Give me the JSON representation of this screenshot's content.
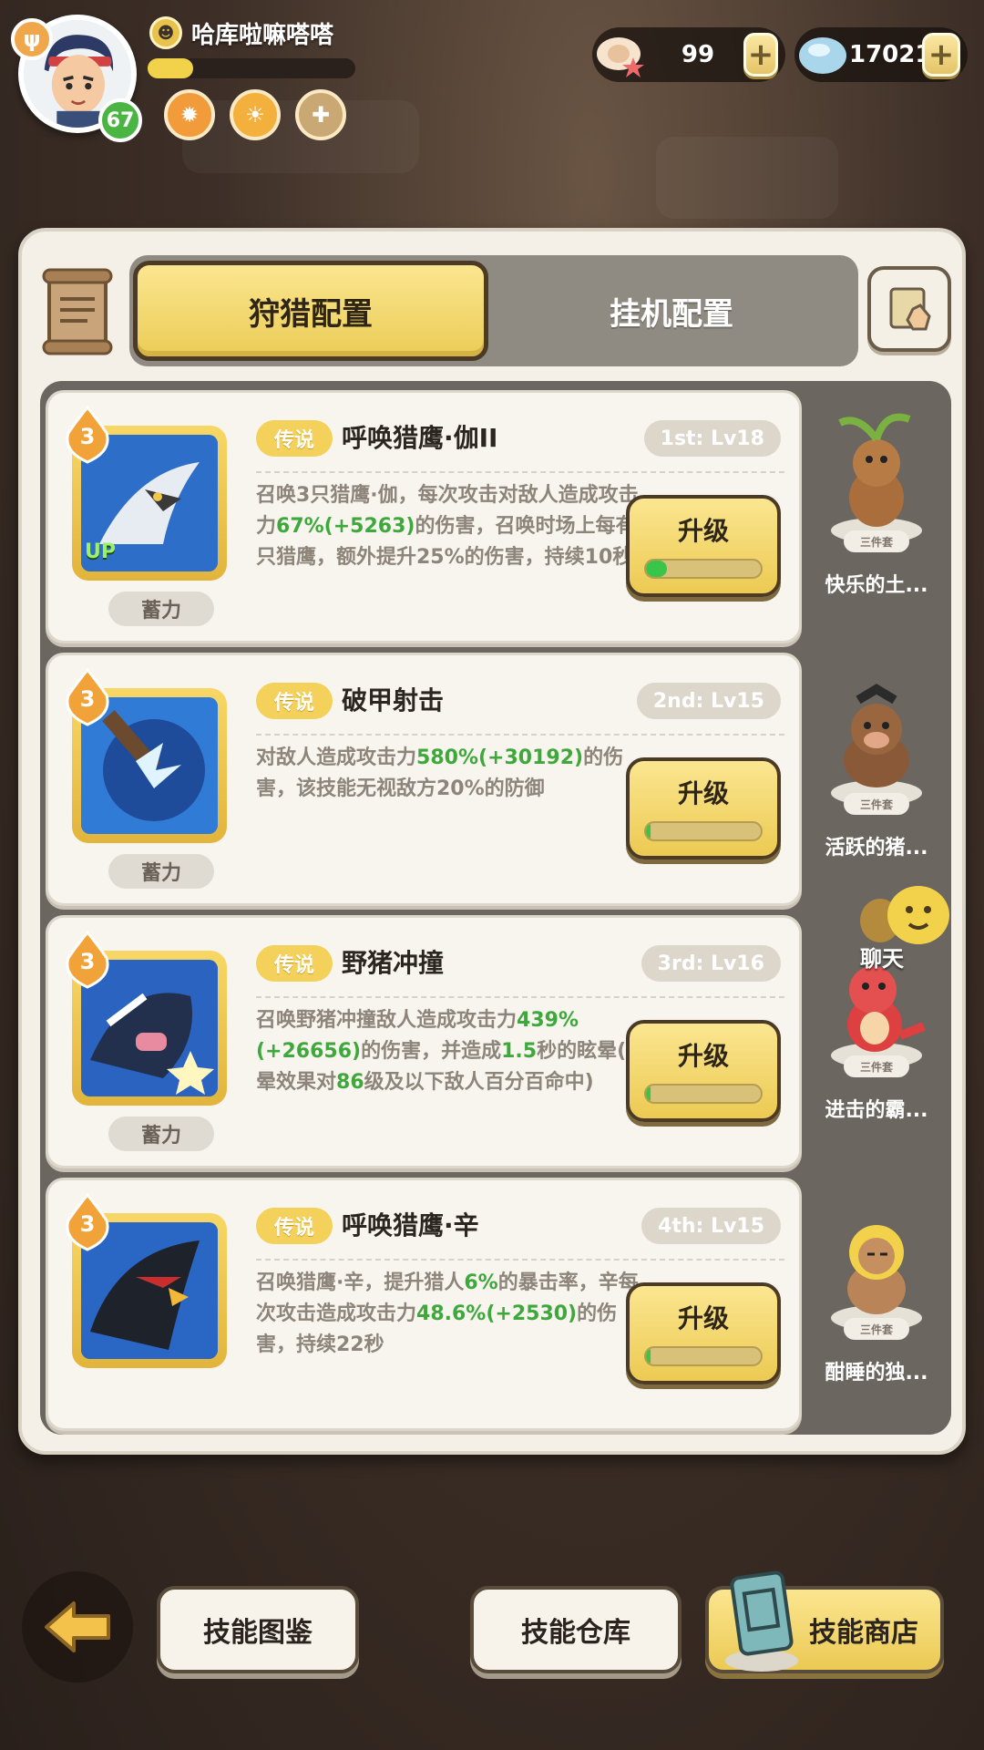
{
  "player": {
    "name": "哈库啦嘛嗒嗒",
    "level": "67",
    "xp_fraction": 0.22,
    "buffs": [
      "fire-buff-icon",
      "sun-buff-icon",
      "shield-buff-icon"
    ]
  },
  "currencies": [
    {
      "icon": "shell-starfish-icon",
      "value": "99"
    },
    {
      "icon": "crystal-icon",
      "value": "17021"
    }
  ],
  "tabs": {
    "hunt_config": "狩猎配置",
    "idle_config": "挂机配置"
  },
  "skills": [
    {
      "rank": "3",
      "up": "UP",
      "tag": "蓄力",
      "rarity": "传说",
      "name": "呼唤猎鹰·伽II",
      "slot": "1st: Lv18",
      "desc": "召唤3只猎鹰·伽，每次攻击对敌人造成攻击力|67%(+5263)|的伤害，召唤时场上每有1只猎鹰，额外提升25%的伤害，持续10秒",
      "upgrade_label": "升级",
      "progress": 0.18,
      "pet_name": "快乐的土...",
      "set_tag": "三件套"
    },
    {
      "rank": "3",
      "up": "",
      "tag": "蓄力",
      "rarity": "传说",
      "name": "破甲射击",
      "slot": "2nd: Lv15",
      "desc": "对敌人造成攻击力|580%(+30192)|的伤害，该技能无视敌方20%的防御",
      "upgrade_label": "升级",
      "progress": 0.04,
      "pet_name": "活跃的猪...",
      "set_tag": "三件套"
    },
    {
      "rank": "3",
      "up": "",
      "tag": "蓄力",
      "rarity": "传说",
      "name": "野猪冲撞",
      "slot": "3rd: Lv16",
      "desc": "召唤野猪冲撞敌人造成攻击力|439%(+26656)|的伤害，并造成|1.5|秒的眩晕(眩晕效果对|86|级及以下敌人百分百命中)",
      "upgrade_label": "升级",
      "progress": 0.04,
      "pet_name": "进击的霸...",
      "set_tag": "三件套"
    },
    {
      "rank": "3",
      "up": "",
      "tag": "",
      "rarity": "传说",
      "name": "呼唤猎鹰·辛",
      "slot": "4th: Lv15",
      "desc": "召唤猎鹰·辛，提升猎人|6%|的暴击率，辛每次攻击造成攻击力|48.6%(+2530)|的伤害，持续22秒",
      "upgrade_label": "升级",
      "progress": 0.04,
      "pet_name": "酣睡的独...",
      "set_tag": "三件套"
    }
  ],
  "chat": {
    "label": "聊天"
  },
  "bottom": {
    "codex": "技能图鉴",
    "storage": "技能仓库",
    "shop": "技能商店"
  },
  "colors": {
    "accent_yellow": "#f3d15a",
    "highlight_green": "#3fa83c",
    "panel": "#f4f0e7"
  }
}
